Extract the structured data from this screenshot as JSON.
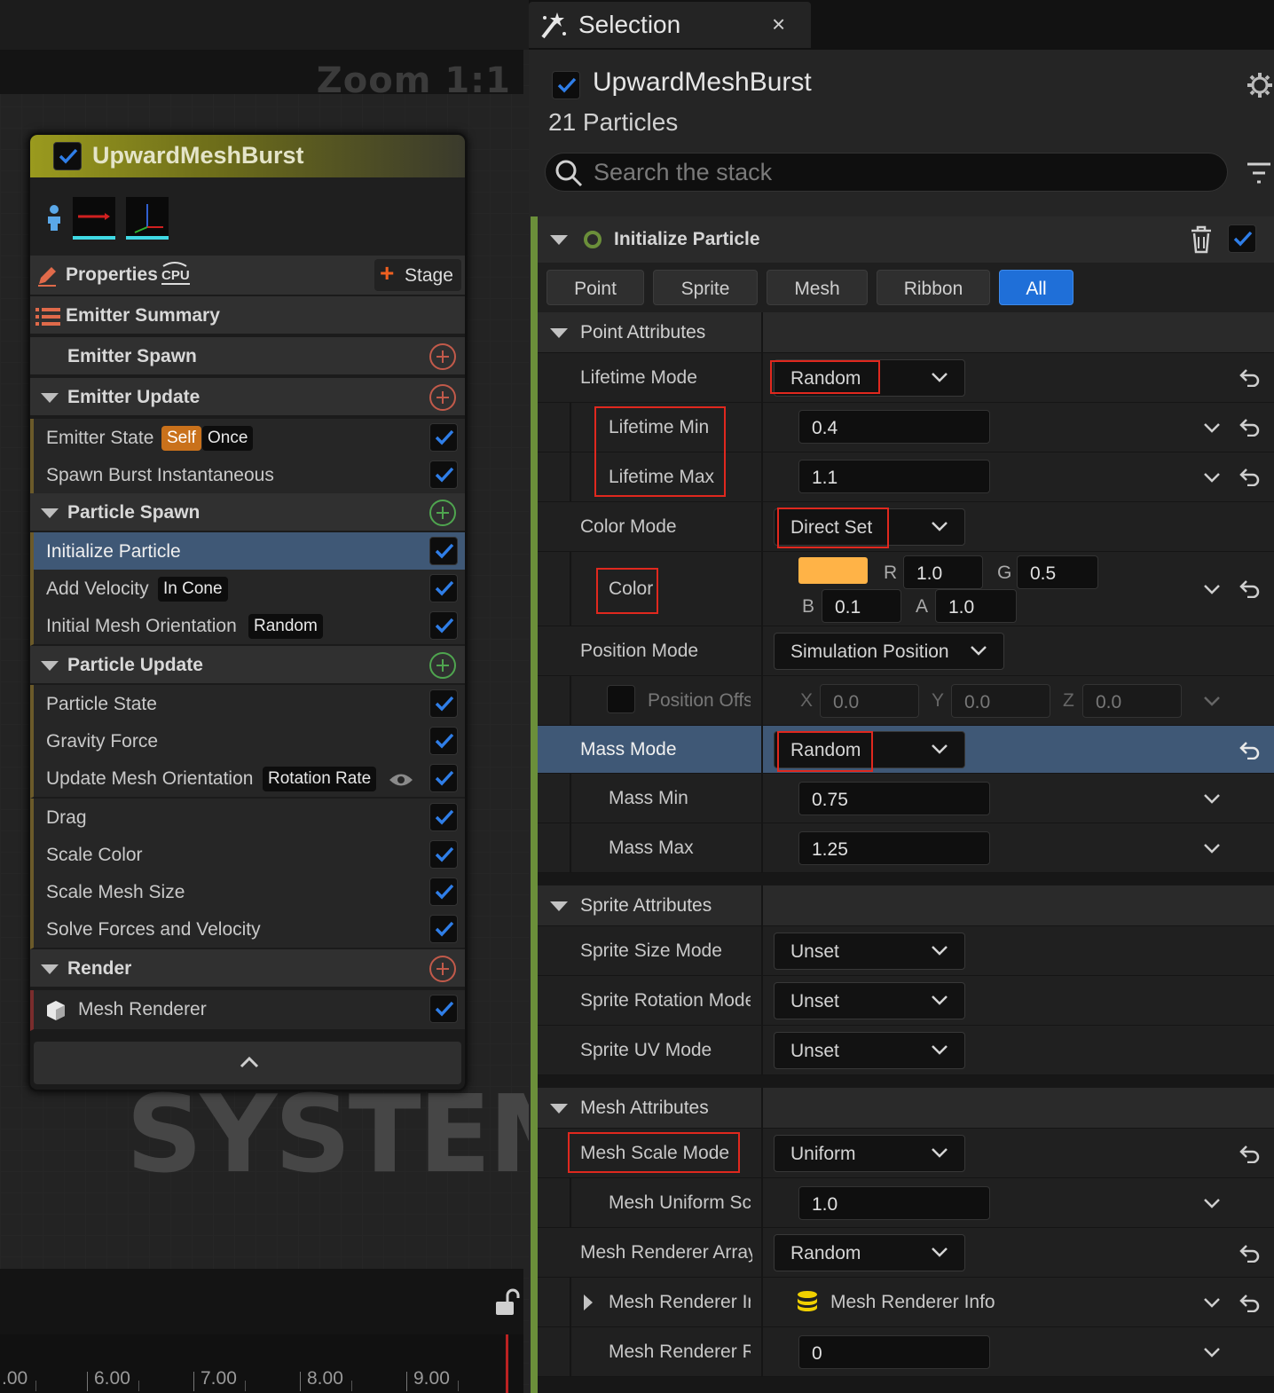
{
  "graph": {
    "zoom_label": "Zoom 1:1",
    "watermark": "SYSTEM",
    "timeline_ticks": [
      ".00",
      "6.00",
      "7.00",
      "8.00",
      "9.00"
    ]
  },
  "node": {
    "title": "UpwardMeshBurst",
    "properties_label": "Properties",
    "cpu_badge": "CPU",
    "stage_label": "Stage",
    "emitter_summary": "Emitter Summary",
    "emitter_spawn": "Emitter Spawn",
    "emitter_update": "Emitter Update",
    "emitter_state": {
      "label": "Emitter State",
      "tag1": "Self",
      "tag2": "Once"
    },
    "spawn_burst": "Spawn Burst Instantaneous",
    "particle_spawn": "Particle Spawn",
    "initialize_particle": "Initialize Particle",
    "add_velocity": {
      "label": "Add Velocity",
      "tag": "In Cone"
    },
    "initial_mesh_orientation": {
      "label": "Initial Mesh Orientation",
      "tag": "Random"
    },
    "particle_update": "Particle Update",
    "particle_state": "Particle State",
    "gravity_force": "Gravity Force",
    "update_mesh_orientation": {
      "label": "Update Mesh Orientation",
      "tag": "Rotation Rate"
    },
    "drag": "Drag",
    "scale_color": "Scale Color",
    "scale_mesh_size": "Scale Mesh Size",
    "solve_forces": "Solve Forces and Velocity",
    "render": "Render",
    "mesh_renderer": "Mesh Renderer"
  },
  "panel": {
    "tab_title": "Selection",
    "tab_close": "×",
    "emitter_name": "UpwardMeshBurst",
    "particle_count": "21 Particles",
    "search_placeholder": "Search the stack",
    "module_title": "Initialize Particle",
    "filter_tabs": [
      "Point",
      "Sprite",
      "Mesh",
      "Ribbon",
      "All"
    ],
    "active_tab": "All",
    "point_attributes": "Point Attributes",
    "lifetime_mode": {
      "label": "Lifetime Mode",
      "value": "Random"
    },
    "lifetime_min": {
      "label": "Lifetime Min",
      "value": "0.4"
    },
    "lifetime_max": {
      "label": "Lifetime Max",
      "value": "1.1"
    },
    "color_mode": {
      "label": "Color Mode",
      "value": "Direct Set"
    },
    "color": {
      "label": "Color",
      "swatch": "#ffb347",
      "r_label": "R",
      "r": "1.0",
      "g_label": "G",
      "g": "0.5",
      "b_label": "B",
      "b": "0.1",
      "a_label": "A",
      "a": "1.0"
    },
    "position_mode": {
      "label": "Position Mode",
      "value": "Simulation Position"
    },
    "position_offset": {
      "label": "Position Offs",
      "x_label": "X",
      "x": "0.0",
      "y_label": "Y",
      "y": "0.0",
      "z_label": "Z",
      "z": "0.0"
    },
    "mass_mode": {
      "label": "Mass Mode",
      "value": "Random"
    },
    "mass_min": {
      "label": "Mass Min",
      "value": "0.75"
    },
    "mass_max": {
      "label": "Mass Max",
      "value": "1.25"
    },
    "sprite_attributes": "Sprite Attributes",
    "sprite_size_mode": {
      "label": "Sprite Size Mode",
      "value": "Unset"
    },
    "sprite_rotation_mode": {
      "label": "Sprite Rotation Mode",
      "value": "Unset"
    },
    "sprite_uv_mode": {
      "label": "Sprite UV Mode",
      "value": "Unset"
    },
    "mesh_attributes": "Mesh Attributes",
    "mesh_scale_mode": {
      "label": "Mesh Scale Mode",
      "value": "Uniform"
    },
    "mesh_uniform_scale": {
      "label": "Mesh Uniform Sc",
      "value": "1.0"
    },
    "mesh_renderer_array": {
      "label": "Mesh Renderer Array",
      "value": "Random"
    },
    "mesh_renderer_info": {
      "label": "Mesh Renderer Ir",
      "value": "Mesh Renderer Info"
    },
    "mesh_renderer_r": {
      "label": "Mesh Renderer R",
      "value": "0"
    }
  },
  "colors": {
    "accent_blue": "#1f6fd8",
    "highlight_red": "#e0281e",
    "selected_row": "#3f5876",
    "module_green": "#6b8f3a"
  }
}
